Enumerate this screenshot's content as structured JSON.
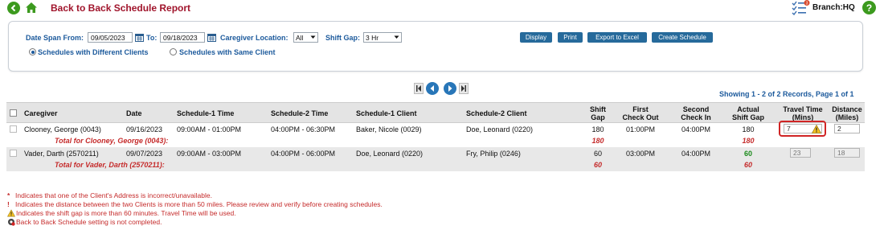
{
  "header": {
    "title": "Back to Back Schedule Report",
    "branch_label": "Branch:HQ",
    "notification_count": "3",
    "help_label": "?"
  },
  "filters": {
    "date_from_label": "Date Span From:",
    "date_from": "09/05/2023",
    "date_to_label": "To:",
    "date_to": "09/18/2023",
    "location_label": "Caregiver Location:",
    "location_value": "All",
    "shift_gap_label": "Shift Gap:",
    "shift_gap_value": "3 Hr",
    "radio_different": "Schedules with Different Clients",
    "radio_same": "Schedules with Same Client",
    "selected_radio": "different"
  },
  "actions": {
    "display": "Display",
    "print": "Print",
    "export": "Export to Excel",
    "create": "Create Schedule"
  },
  "pager": {
    "records_text": "Showing 1 - 2 of 2 Records, Page 1 of 1"
  },
  "table": {
    "headers": {
      "caregiver": "Caregiver",
      "date": "Date",
      "s1_time": "Schedule-1 Time",
      "s2_time": "Schedule-2 Time",
      "s1_client": "Schedule-1 Client",
      "s2_client": "Schedule-2 Client",
      "shift_gap_1": "Shift",
      "shift_gap_2": "Gap",
      "first_checkout_1": "First",
      "first_checkout_2": "Check Out",
      "second_checkin_1": "Second",
      "second_checkin_2": "Check In",
      "actual_gap_1": "Actual",
      "actual_gap_2": "Shift Gap",
      "travel_1": "Travel Time",
      "travel_2": "(Mins)",
      "distance_1": "Distance",
      "distance_2": "(Miles)"
    },
    "rows": [
      {
        "caregiver": "Clooney, George (0043)",
        "date": "09/16/2023",
        "s1_time": "09:00AM - 01:00PM",
        "s2_time": "04:00PM - 06:30PM",
        "s1_client": "Baker, Nicole (0029)",
        "s2_client": "Doe, Leonard (0220)",
        "shift_gap": "180",
        "first_checkout": "01:00PM",
        "second_checkin": "04:00PM",
        "actual_gap": "180",
        "travel_time": "7",
        "distance": "2",
        "total_label": "Total for Clooney, George (0043):",
        "total_shift_gap": "180",
        "total_actual_gap": "180"
      },
      {
        "caregiver": "Vader, Darth (2570211)",
        "date": "09/07/2023",
        "s1_time": "09:00AM - 03:00PM",
        "s2_time": "04:00PM - 06:00PM",
        "s1_client": "Doe, Leonard (0220)",
        "s2_client": "Fry, Philip (0246)",
        "shift_gap": "60",
        "first_checkout": "03:00PM",
        "second_checkin": "04:00PM",
        "actual_gap": "60",
        "travel_time": "23",
        "distance": "18",
        "total_label": "Total for Vader, Darth (2570211):",
        "total_shift_gap": "60",
        "total_actual_gap": "60"
      }
    ]
  },
  "legend": [
    {
      "mark": "*",
      "text": "Indicates that one of the Client's Address is incorrect/unavailable."
    },
    {
      "mark": "!",
      "text": "Indicates the distance between the two Clients is more than 50 miles. Please review and verify before creating schedules."
    },
    {
      "mark": "",
      "text": "Indicates the shift gap is more than 60 minutes. Travel Time will be used."
    },
    {
      "mark": "",
      "text": "Back to Back Schedule setting is not completed."
    }
  ],
  "colors": {
    "title": "#a0142b",
    "label_blue": "#1c5a9c",
    "button_blue": "#266a9b",
    "total_red": "#c52b2b",
    "green": "#1a8a1a"
  }
}
